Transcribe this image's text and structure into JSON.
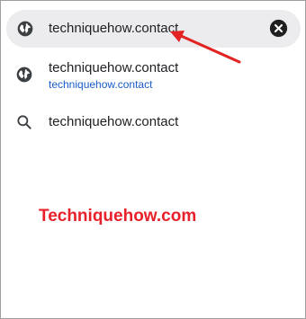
{
  "address_bar": {
    "url": "techniquehow.contact",
    "icon": "globe-icon",
    "clear_icon": "close-circle-icon"
  },
  "suggestions": [
    {
      "icon": "globe-icon",
      "title": "techniquehow.contact",
      "url": "techniquehow.contact"
    },
    {
      "icon": "search-icon",
      "title": "techniquehow.contact"
    }
  ],
  "watermark": {
    "text": "Techniquehow.com",
    "color": "#e8202a"
  },
  "colors": {
    "address_bar_bg": "#ececef",
    "link": "#1a5cc8",
    "arrow": "#e32222"
  }
}
